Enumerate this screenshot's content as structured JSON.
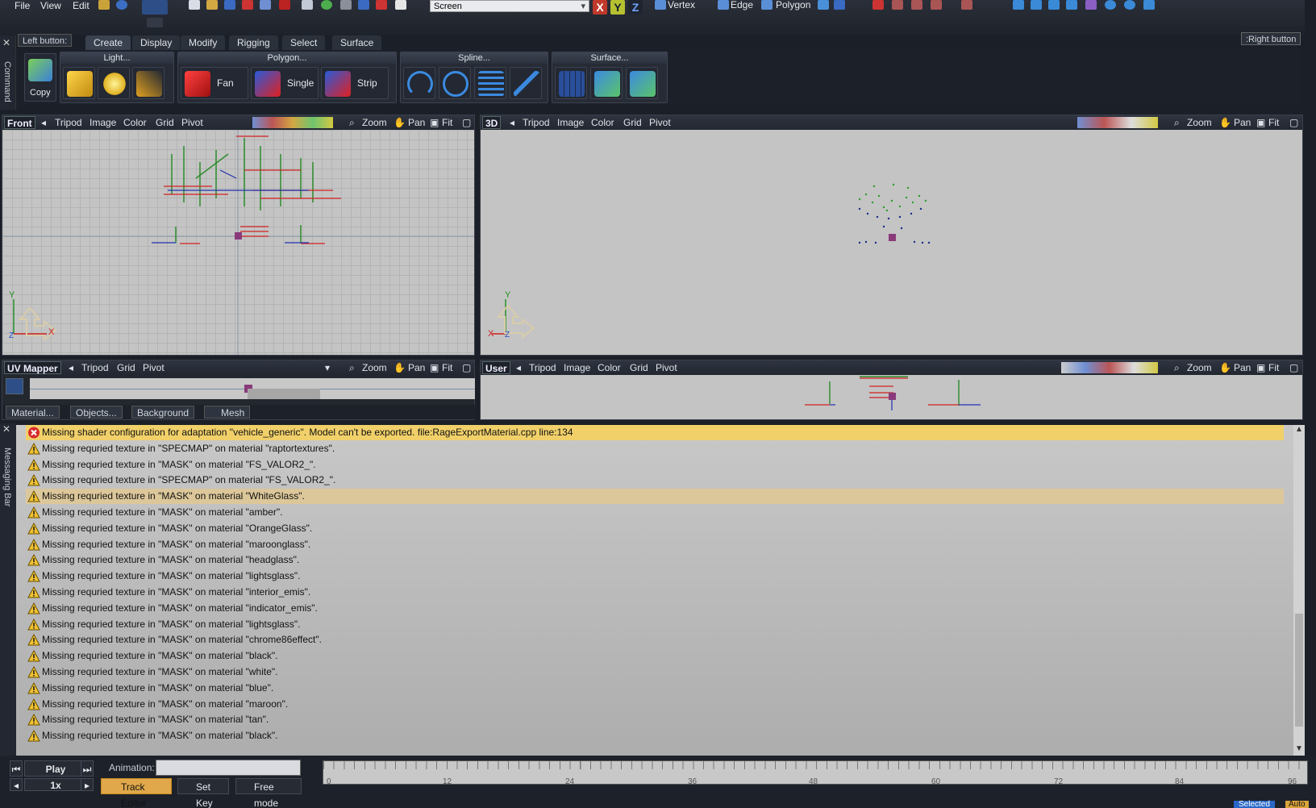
{
  "menu": {
    "file": "File",
    "view": "View",
    "edit": "Edit"
  },
  "toolbar": {
    "screen_value": "Screen",
    "axis_x": "X",
    "axis_y": "Y",
    "axis_z": "Z",
    "vertex": "Vertex",
    "edge": "Edge",
    "polygon": "Polygon"
  },
  "command": {
    "side_label": "Command",
    "left_button": "Left button:",
    "right_button": ":Right button",
    "tabs": [
      "Create",
      "Display",
      "Modify",
      "Rigging",
      "Select",
      "Surface"
    ],
    "copy_label": "Copy",
    "groups": {
      "light": "Light...",
      "polygon": "Polygon...",
      "spline": "Spline...",
      "surface": "Surface..."
    },
    "poly_buttons": [
      "Fan",
      "Single",
      "Strip"
    ]
  },
  "viewports": {
    "front": {
      "name": "Front",
      "items": [
        "Tripod",
        "Image",
        "Color",
        "Grid",
        "Pivot"
      ],
      "zoom": "Zoom",
      "pan": "Pan",
      "fit": "Fit",
      "axis_x": "X",
      "axis_y": "Y",
      "axis_z": "Z"
    },
    "three_d": {
      "name": "3D",
      "items": [
        "Tripod",
        "Image",
        "Color",
        "Grid",
        "Pivot"
      ],
      "zoom": "Zoom",
      "pan": "Pan",
      "fit": "Fit",
      "axis_x": "X",
      "axis_y": "Y",
      "axis_z": "Z"
    },
    "uv": {
      "name": "UV Mapper",
      "items": [
        "Tripod",
        "Grid",
        "Pivot"
      ],
      "zoom": "Zoom",
      "pan": "Pan",
      "fit": "Fit",
      "tabs": [
        "Material...",
        "Objects...",
        "Background",
        "Mesh"
      ]
    },
    "user": {
      "name": "User",
      "items": [
        "Tripod",
        "Image",
        "Color",
        "Grid",
        "Pivot"
      ],
      "zoom": "Zoom",
      "pan": "Pan",
      "fit": "Fit"
    }
  },
  "messages": {
    "side_label": "Messaging Bar",
    "items": [
      {
        "type": "error",
        "text": "Missing shader configuration for adaptation \"vehicle_generic\". Model can't be exported. file:RageExportMaterial.cpp line:134"
      },
      {
        "type": "warning",
        "text": "Missing requried texture in \"SPECMAP\" on material \"raptortextures\"."
      },
      {
        "type": "warning",
        "text": "Missing requried texture in \"MASK\" on material \"FS_VALOR2_\"."
      },
      {
        "type": "warning",
        "text": "Missing requried texture in \"SPECMAP\" on material \"FS_VALOR2_\"."
      },
      {
        "type": "warning",
        "text": "Missing requried texture in \"MASK\" on material \"WhiteGlass\".",
        "selected": true
      },
      {
        "type": "warning",
        "text": "Missing requried texture in \"MASK\" on material \"amber\"."
      },
      {
        "type": "warning",
        "text": "Missing requried texture in \"MASK\" on material \"OrangeGlass\"."
      },
      {
        "type": "warning",
        "text": "Missing requried texture in \"MASK\" on material \"maroonglass\"."
      },
      {
        "type": "warning",
        "text": "Missing requried texture in \"MASK\" on material \"headglass\"."
      },
      {
        "type": "warning",
        "text": "Missing requried texture in \"MASK\" on material \"lightsglass\"."
      },
      {
        "type": "warning",
        "text": "Missing requried texture in \"MASK\" on material \"interior_emis\"."
      },
      {
        "type": "warning",
        "text": "Missing requried texture in \"MASK\" on material \"indicator_emis\"."
      },
      {
        "type": "warning",
        "text": "Missing requried texture in \"MASK\" on material \"lightsglass\"."
      },
      {
        "type": "warning",
        "text": "Missing requried texture in \"MASK\" on material \"chrome86effect\"."
      },
      {
        "type": "warning",
        "text": "Missing requried texture in \"MASK\" on material \"black\"."
      },
      {
        "type": "warning",
        "text": "Missing requried texture in \"MASK\" on material \"white\"."
      },
      {
        "type": "warning",
        "text": "Missing requried texture in \"MASK\" on material \"blue\"."
      },
      {
        "type": "warning",
        "text": "Missing requried texture in \"MASK\" on material \"maroon\"."
      },
      {
        "type": "warning",
        "text": "Missing requried texture in \"MASK\" on material \"tan\"."
      },
      {
        "type": "warning",
        "text": "Missing requried texture in \"MASK\" on material \"black\"."
      }
    ]
  },
  "bottom": {
    "play": "Play",
    "speed": "1x",
    "animation_label": "Animation:",
    "track_editor": "Track Editor",
    "set_key": "Set Key",
    "free_mode": "Free mode",
    "ticks": [
      "0",
      "12",
      "24",
      "36",
      "48",
      "60",
      "72",
      "84",
      "96"
    ],
    "status_selected": "Selected",
    "status_auto": "Auto"
  },
  "colors": {
    "error_row": "#f1d06a",
    "selected_row": "#dcc79a",
    "viewport_bg": "#c4c4c4",
    "chrome_bg": "#1b1f27"
  }
}
